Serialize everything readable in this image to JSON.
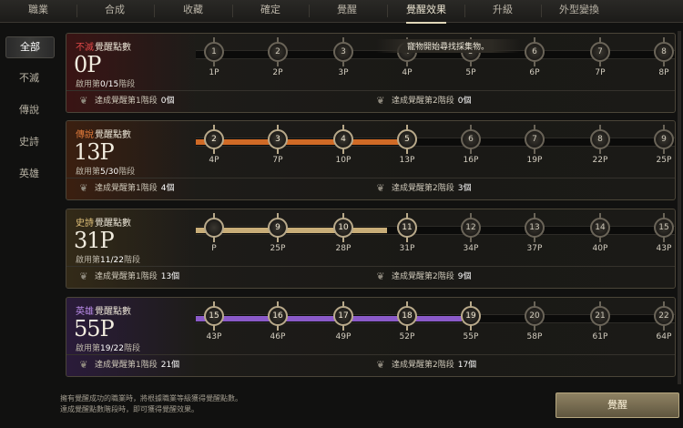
{
  "tabs": [
    {
      "label": "職業",
      "active": false
    },
    {
      "label": "合成",
      "active": false
    },
    {
      "label": "收藏",
      "active": false
    },
    {
      "label": "確定",
      "active": false
    },
    {
      "label": "覺醒",
      "active": false
    },
    {
      "label": "覺醒效果",
      "active": true
    },
    {
      "label": "升級",
      "active": false
    },
    {
      "label": "外型變換",
      "active": false
    }
  ],
  "filters": [
    {
      "label": "全部",
      "active": true
    },
    {
      "label": "不滅",
      "active": false
    },
    {
      "label": "傳說",
      "active": false
    },
    {
      "label": "史詩",
      "active": false
    },
    {
      "label": "英雄",
      "active": false
    }
  ],
  "tooltip": "寵物開始尋找採集物。",
  "panels": [
    {
      "tier": "不滅",
      "tier_color": "#e04848",
      "title_suffix": "覺醒點數",
      "points": "0P",
      "stage_prefix": "啟用第",
      "stage_value": "0/15",
      "stage_suffix": "階段",
      "fill_color": "#c9a55a",
      "tint": "#3a1414",
      "nodes": [
        {
          "n": "1",
          "label": "1P",
          "on": false
        },
        {
          "n": "2",
          "label": "2P",
          "on": false
        },
        {
          "n": "3",
          "label": "3P",
          "on": false
        },
        {
          "n": "4",
          "label": "4P",
          "on": false
        },
        {
          "n": "5",
          "label": "5P",
          "on": false
        },
        {
          "n": "6",
          "label": "6P",
          "on": false
        },
        {
          "n": "7",
          "label": "7P",
          "on": false
        },
        {
          "n": "8",
          "label": "8P",
          "on": false
        }
      ],
      "reward1_label": "達成覺醒第1階段",
      "reward1_count": "0個",
      "reward2_label": "達成覺醒第2階段",
      "reward2_count": "0個"
    },
    {
      "tier": "傳說",
      "tier_color": "#e07a3a",
      "title_suffix": "覺醒點數",
      "points": "13P",
      "stage_prefix": "啟用第",
      "stage_value": "5/30",
      "stage_suffix": "階段",
      "fill_color": "#d06a26",
      "tint": "#3b1f10",
      "nodes": [
        {
          "n": "2",
          "label": "4P",
          "on": true
        },
        {
          "n": "3",
          "label": "7P",
          "on": true
        },
        {
          "n": "4",
          "label": "10P",
          "on": true
        },
        {
          "n": "5",
          "label": "13P",
          "on": true
        },
        {
          "n": "6",
          "label": "16P",
          "on": false
        },
        {
          "n": "7",
          "label": "19P",
          "on": false
        },
        {
          "n": "8",
          "label": "22P",
          "on": false
        },
        {
          "n": "9",
          "label": "25P",
          "on": false
        }
      ],
      "reward1_label": "達成覺醒第1階段",
      "reward1_count": "4個",
      "reward2_label": "達成覺醒第2階段",
      "reward2_count": "3個"
    },
    {
      "tier": "史詩",
      "tier_color": "#e2c27a",
      "title_suffix": "覺醒點數",
      "points": "31P",
      "stage_prefix": "啟用第",
      "stage_value": "11/22",
      "stage_suffix": "階段",
      "fill_color": "#c8ad78",
      "tint": "#332a18",
      "nodes": [
        {
          "n": "",
          "label": "P",
          "on": true
        },
        {
          "n": "9",
          "label": "25P",
          "on": true
        },
        {
          "n": "10",
          "label": "28P",
          "on": true
        },
        {
          "n": "11",
          "label": "31P",
          "on": true
        },
        {
          "n": "12",
          "label": "34P",
          "on": false
        },
        {
          "n": "13",
          "label": "37P",
          "on": false
        },
        {
          "n": "14",
          "label": "40P",
          "on": false
        },
        {
          "n": "15",
          "label": "43P",
          "on": false
        }
      ],
      "reward1_label": "達成覺醒第1階段",
      "reward1_count": "13個",
      "reward2_label": "達成覺醒第2階段",
      "reward2_count": "9個"
    },
    {
      "tier": "英雄",
      "tier_color": "#b88ae6",
      "title_suffix": "覺醒點數",
      "points": "55P",
      "stage_prefix": "啟用第",
      "stage_value": "19/22",
      "stage_suffix": "階段",
      "fill_color": "#8a5ac8",
      "tint": "#2a1b3a",
      "nodes": [
        {
          "n": "15",
          "label": "43P",
          "on": true
        },
        {
          "n": "16",
          "label": "46P",
          "on": true
        },
        {
          "n": "17",
          "label": "49P",
          "on": true
        },
        {
          "n": "18",
          "label": "52P",
          "on": true
        },
        {
          "n": "19",
          "label": "55P",
          "on": true
        },
        {
          "n": "20",
          "label": "58P",
          "on": false
        },
        {
          "n": "21",
          "label": "61P",
          "on": false
        },
        {
          "n": "22",
          "label": "64P",
          "on": false
        }
      ],
      "reward1_label": "達成覺醒第1階段",
      "reward1_count": "21個",
      "reward2_label": "達成覺醒第2階段",
      "reward2_count": "17個"
    }
  ],
  "footnote_line1": "擁有覺醒成功的職業時，將根據職業等級獲得覺醒點數。",
  "footnote_line2": "達成覺醒點數階段時，即可獲得覺醒效果。",
  "awaken_button": "覺醒"
}
